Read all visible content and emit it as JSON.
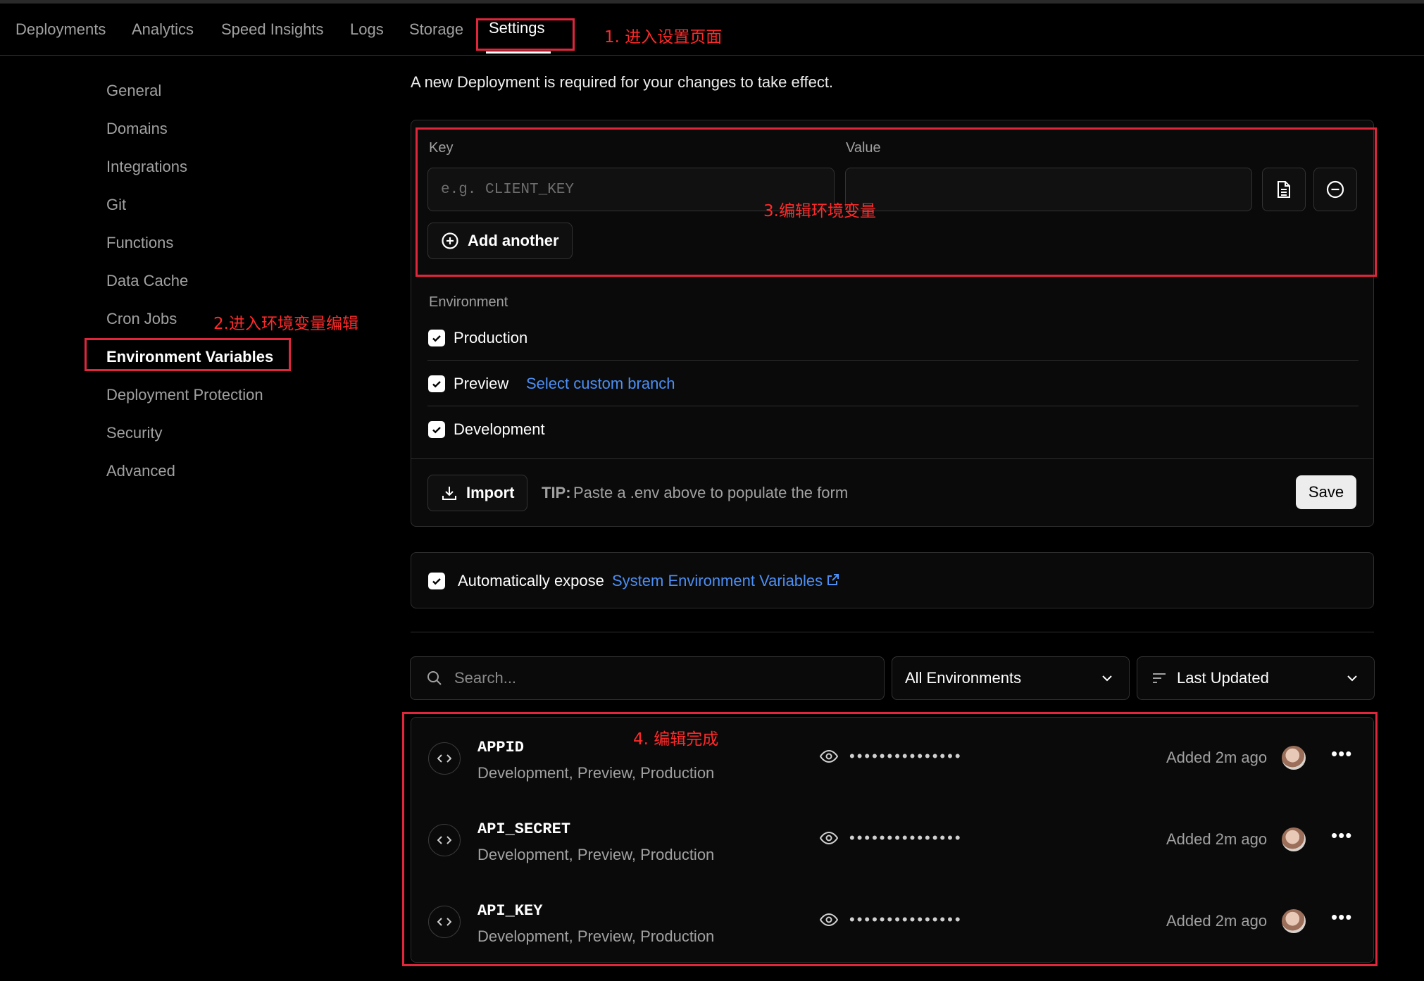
{
  "nav": {
    "tabs": [
      {
        "label": "Deployments"
      },
      {
        "label": "Analytics"
      },
      {
        "label": "Speed Insights"
      },
      {
        "label": "Logs"
      },
      {
        "label": "Storage"
      },
      {
        "label": "Settings"
      }
    ],
    "active_tab": "Settings"
  },
  "annotations": {
    "step1": "1. 进入设置页面",
    "step2": "2.进入环境变量编辑",
    "step3": "3.编辑环境变量",
    "step4": "4. 编辑完成",
    "color": "#e0263b"
  },
  "sidebar": {
    "items": [
      {
        "label": "General"
      },
      {
        "label": "Domains"
      },
      {
        "label": "Integrations"
      },
      {
        "label": "Git"
      },
      {
        "label": "Functions"
      },
      {
        "label": "Data Cache"
      },
      {
        "label": "Cron Jobs"
      },
      {
        "label": "Environment Variables"
      },
      {
        "label": "Deployment Protection"
      },
      {
        "label": "Security"
      },
      {
        "label": "Advanced"
      }
    ],
    "active": "Environment Variables"
  },
  "main": {
    "notice": "A new Deployment is required for your changes to take effect.",
    "form": {
      "key_label": "Key",
      "value_label": "Value",
      "key_placeholder": "e.g. CLIENT_KEY",
      "value_value": "",
      "add_another": "Add another",
      "environment_label": "Environment",
      "environments": [
        {
          "label": "Production",
          "checked": true
        },
        {
          "label": "Preview",
          "checked": true,
          "link": "Select custom branch"
        },
        {
          "label": "Development",
          "checked": true
        }
      ],
      "import_label": "Import",
      "tip_bold": "TIP:",
      "tip_text": "Paste a .env above to populate the form",
      "save_label": "Save"
    },
    "expose": {
      "checked": true,
      "text": "Automatically expose",
      "link": "System Environment Variables"
    },
    "filters": {
      "search_placeholder": "Search...",
      "environment_select": "All Environments",
      "sort_select": "Last Updated"
    },
    "variables": [
      {
        "key": "APPID",
        "envs": "Development, Preview, Production",
        "masked": "•••••••••••••••",
        "added": "Added 2m ago"
      },
      {
        "key": "API_SECRET",
        "envs": "Development, Preview, Production",
        "masked": "•••••••••••••••",
        "added": "Added 2m ago"
      },
      {
        "key": "API_KEY",
        "envs": "Development, Preview, Production",
        "masked": "•••••••••••••••",
        "added": "Added 2m ago"
      }
    ]
  }
}
